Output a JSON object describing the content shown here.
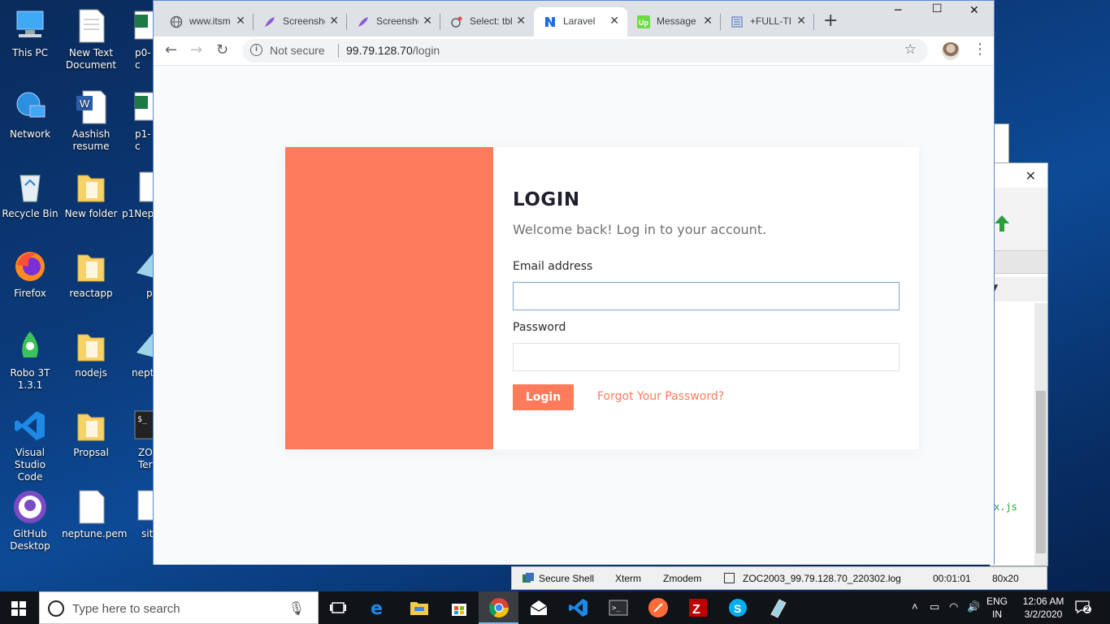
{
  "desktop": {
    "icons": [
      {
        "label": "This PC"
      },
      {
        "label": "New Text Document"
      },
      {
        "label": "p0-c"
      },
      {
        "label": "Network"
      },
      {
        "label": "Aashish resume"
      },
      {
        "label": "p1-c"
      },
      {
        "label": "Recycle Bin"
      },
      {
        "label": "New folder"
      },
      {
        "label": "p1Nep"
      },
      {
        "label": "Firefox"
      },
      {
        "label": "reactapp"
      },
      {
        "label": "p"
      },
      {
        "label": "Robo 3T 1.3.1"
      },
      {
        "label": "nodejs"
      },
      {
        "label": "nept"
      },
      {
        "label": "Visual Studio Code"
      },
      {
        "label": "Propsal"
      },
      {
        "label": "ZO Term"
      },
      {
        "label": "GitHub Desktop"
      },
      {
        "label": "neptune.pem"
      },
      {
        "label": "sit"
      }
    ]
  },
  "background_window": {
    "dropdown_text": "y",
    "file_label": "x.js"
  },
  "zoc": {
    "secure_shell": "Secure Shell",
    "xterm": "Xterm",
    "zmodem": "Zmodem",
    "logfile": "ZOC2003_99.79.128.70_220302.log",
    "timer": "00:01:01",
    "size": "80x20"
  },
  "browser": {
    "tabs": [
      {
        "title": "www.itsm",
        "icon": "globe-icon"
      },
      {
        "title": "Screensho",
        "icon": "feather-icon"
      },
      {
        "title": "Screensho",
        "icon": "feather-icon"
      },
      {
        "title": "Select: tbl",
        "icon": "db-icon"
      },
      {
        "title": "Laravel",
        "icon": "laravel-icon",
        "active": true
      },
      {
        "title": "Message",
        "icon": "upwork-icon"
      },
      {
        "title": "+FULL-TI",
        "icon": "list-icon"
      }
    ],
    "address": {
      "security": "Not secure",
      "host": "99.79.128.70",
      "path": "/login"
    }
  },
  "login": {
    "title": "LOGIN",
    "subtitle": "Welcome back! Log in to your account.",
    "email_label": "Email address",
    "email_value": "",
    "password_label": "Password",
    "password_value": "",
    "submit_label": "Login",
    "forgot_label": "Forgot Your Password?",
    "accent": "#ff7b5c"
  },
  "taskbar": {
    "search_placeholder": "Type here to search",
    "lang_top": "ENG",
    "lang_bottom": "IN",
    "time": "12:06 AM",
    "date": "3/2/2020",
    "notifications": "2"
  }
}
